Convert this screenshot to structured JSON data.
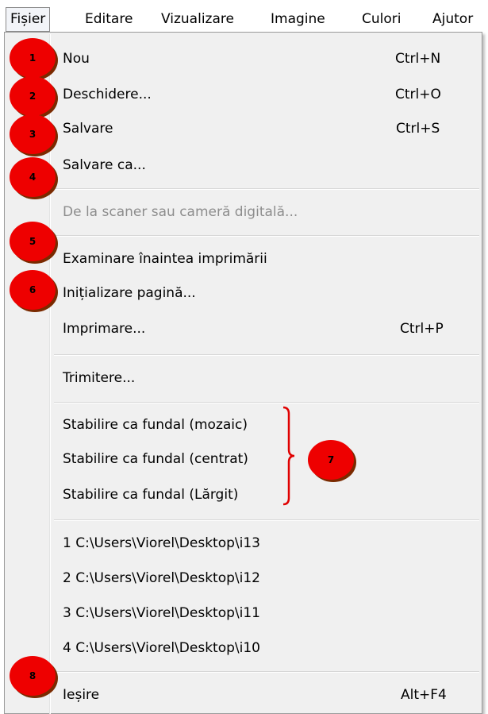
{
  "menubar": {
    "items": [
      {
        "label": "Fișier"
      },
      {
        "label": "Editare"
      },
      {
        "label": "Vizualizare"
      },
      {
        "label": "Imagine"
      },
      {
        "label": "Culori"
      },
      {
        "label": "Ajutor"
      }
    ]
  },
  "menu": {
    "items": [
      {
        "label": "Nou",
        "shortcut": "Ctrl+N"
      },
      {
        "label": "Deschidere...",
        "shortcut": "Ctrl+O"
      },
      {
        "label": "Salvare",
        "shortcut": "Ctrl+S"
      },
      {
        "label": "Salvare ca..."
      },
      {
        "label": "De la scaner sau cameră digitală...",
        "disabled": true
      },
      {
        "label": "Examinare înaintea imprimării"
      },
      {
        "label": "Inițializare pagină..."
      },
      {
        "label": "Imprimare...",
        "shortcut": "Ctrl+P"
      },
      {
        "label": "Trimitere..."
      },
      {
        "label": "Stabilire ca fundal (mozaic)"
      },
      {
        "label": "Stabilire ca fundal (centrat)"
      },
      {
        "label": "Stabilire ca fundal (Lărgit)"
      },
      {
        "label": "1 C:\\Users\\Viorel\\Desktop\\i13"
      },
      {
        "label": "2 C:\\Users\\Viorel\\Desktop\\i12"
      },
      {
        "label": "3 C:\\Users\\Viorel\\Desktop\\i11"
      },
      {
        "label": "4 C:\\Users\\Viorel\\Desktop\\i10"
      },
      {
        "label": "Ieșire",
        "shortcut": "Alt+F4"
      }
    ]
  },
  "markers": [
    "1",
    "2",
    "3",
    "4",
    "5",
    "6",
    "7",
    "8"
  ],
  "colors": {
    "marker": "#ee0000",
    "brace": "#e00000",
    "menu_bg": "#f0f0f0",
    "disabled_text": "#8d8d8d"
  }
}
